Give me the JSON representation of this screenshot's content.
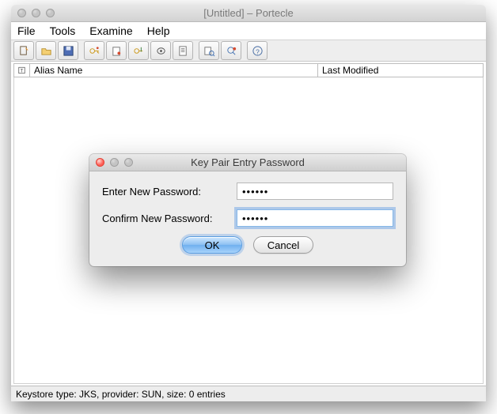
{
  "window": {
    "title": "[Untitled] – Portecle"
  },
  "menubar": {
    "items": [
      "File",
      "Tools",
      "Examine",
      "Help"
    ]
  },
  "toolbar": {
    "icons": [
      "new-keystore-icon",
      "open-keystore-icon",
      "save-keystore-icon",
      "sep",
      "generate-keypair-icon",
      "import-trusted-cert-icon",
      "import-keypair-icon",
      "set-password-icon",
      "keystore-report-icon",
      "sep",
      "examine-cert-icon",
      "examine-ssl-icon",
      "sep",
      "help-icon"
    ]
  },
  "table": {
    "columns": {
      "icon": "T",
      "alias": "Alias Name",
      "modified": "Last Modified"
    },
    "rows": []
  },
  "status": "Keystore type: JKS, provider: SUN, size: 0 entries",
  "dialog": {
    "title": "Key Pair Entry Password",
    "enter_label": "Enter New Password:",
    "confirm_label": "Confirm New Password:",
    "enter_value": "••••••",
    "confirm_value": "••••••",
    "ok_label": "OK",
    "cancel_label": "Cancel"
  }
}
